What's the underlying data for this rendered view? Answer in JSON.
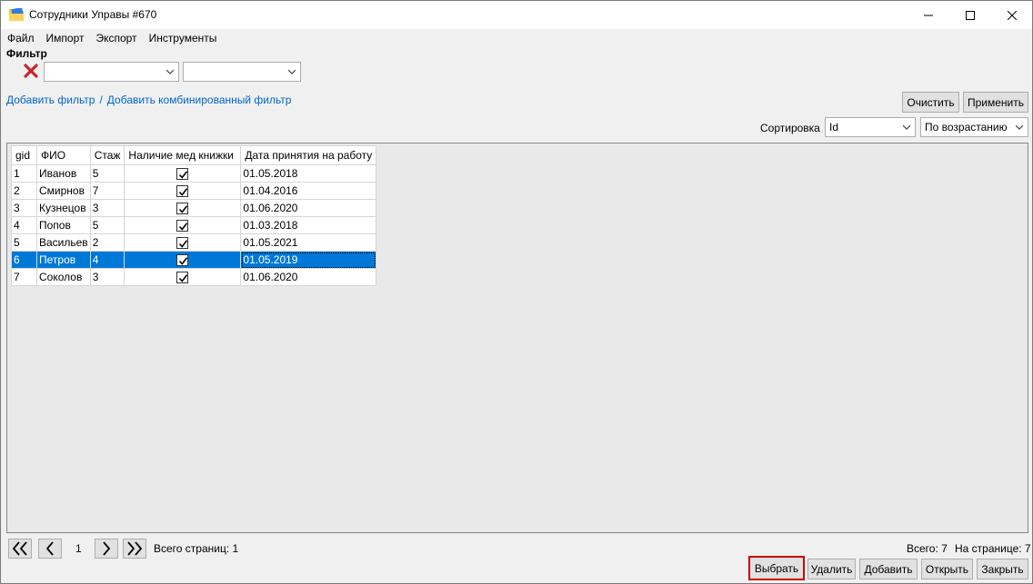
{
  "window": {
    "title": "Сотрудники Управы #670"
  },
  "menu": [
    "Файл",
    "Импорт",
    "Экспорт",
    "Инструменты"
  ],
  "filter": {
    "label": "Фильтр",
    "field_value": "",
    "operator_value": "",
    "add_filter": "Добавить фильтр",
    "separator": "/",
    "add_combined_filter": "Добавить комбинированный фильтр",
    "clear_label": "Очистить",
    "apply_label": "Применить"
  },
  "sort": {
    "label": "Сортировка",
    "field": "Id",
    "order": "По возрастанию"
  },
  "table": {
    "columns": [
      "gid",
      "ФИО",
      "Стаж",
      "Наличие мед книжки",
      "Дата принятия на работу"
    ],
    "rows": [
      {
        "gid": "1",
        "fio": "Иванов",
        "staj": "5",
        "med": true,
        "date": "01.05.2018"
      },
      {
        "gid": "2",
        "fio": "Смирнов",
        "staj": "7",
        "med": true,
        "date": "01.04.2016"
      },
      {
        "gid": "3",
        "fio": "Кузнецов",
        "staj": "3",
        "med": true,
        "date": "01.06.2020"
      },
      {
        "gid": "4",
        "fio": "Попов",
        "staj": "5",
        "med": true,
        "date": "01.03.2018"
      },
      {
        "gid": "5",
        "fio": "Васильев",
        "staj": "2",
        "med": true,
        "date": "01.05.2021"
      },
      {
        "gid": "6",
        "fio": "Петров",
        "staj": "4",
        "med": true,
        "date": "01.05.2019"
      },
      {
        "gid": "7",
        "fio": "Соколов",
        "staj": "3",
        "med": true,
        "date": "01.06.2020"
      }
    ],
    "selected_row": 5
  },
  "pager": {
    "current_page": "1",
    "total_pages_text": "Всего страниц: 1",
    "total_text": "Всего: 7",
    "per_page_text": "На странице: 7"
  },
  "actions": {
    "select": "Выбрать",
    "delete": "Удалить",
    "add": "Добавить",
    "open": "Открыть",
    "close": "Закрыть"
  },
  "colors": {
    "selection": "#0078d7",
    "link": "#0066cc",
    "highlight": "#cc0000"
  },
  "icons": {
    "app": "app-folder-icon",
    "clear_filter": "red-x-icon",
    "first": "double-chevron-left-icon",
    "prev": "chevron-left-icon",
    "next": "chevron-right-icon",
    "last": "double-chevron-right-icon"
  }
}
